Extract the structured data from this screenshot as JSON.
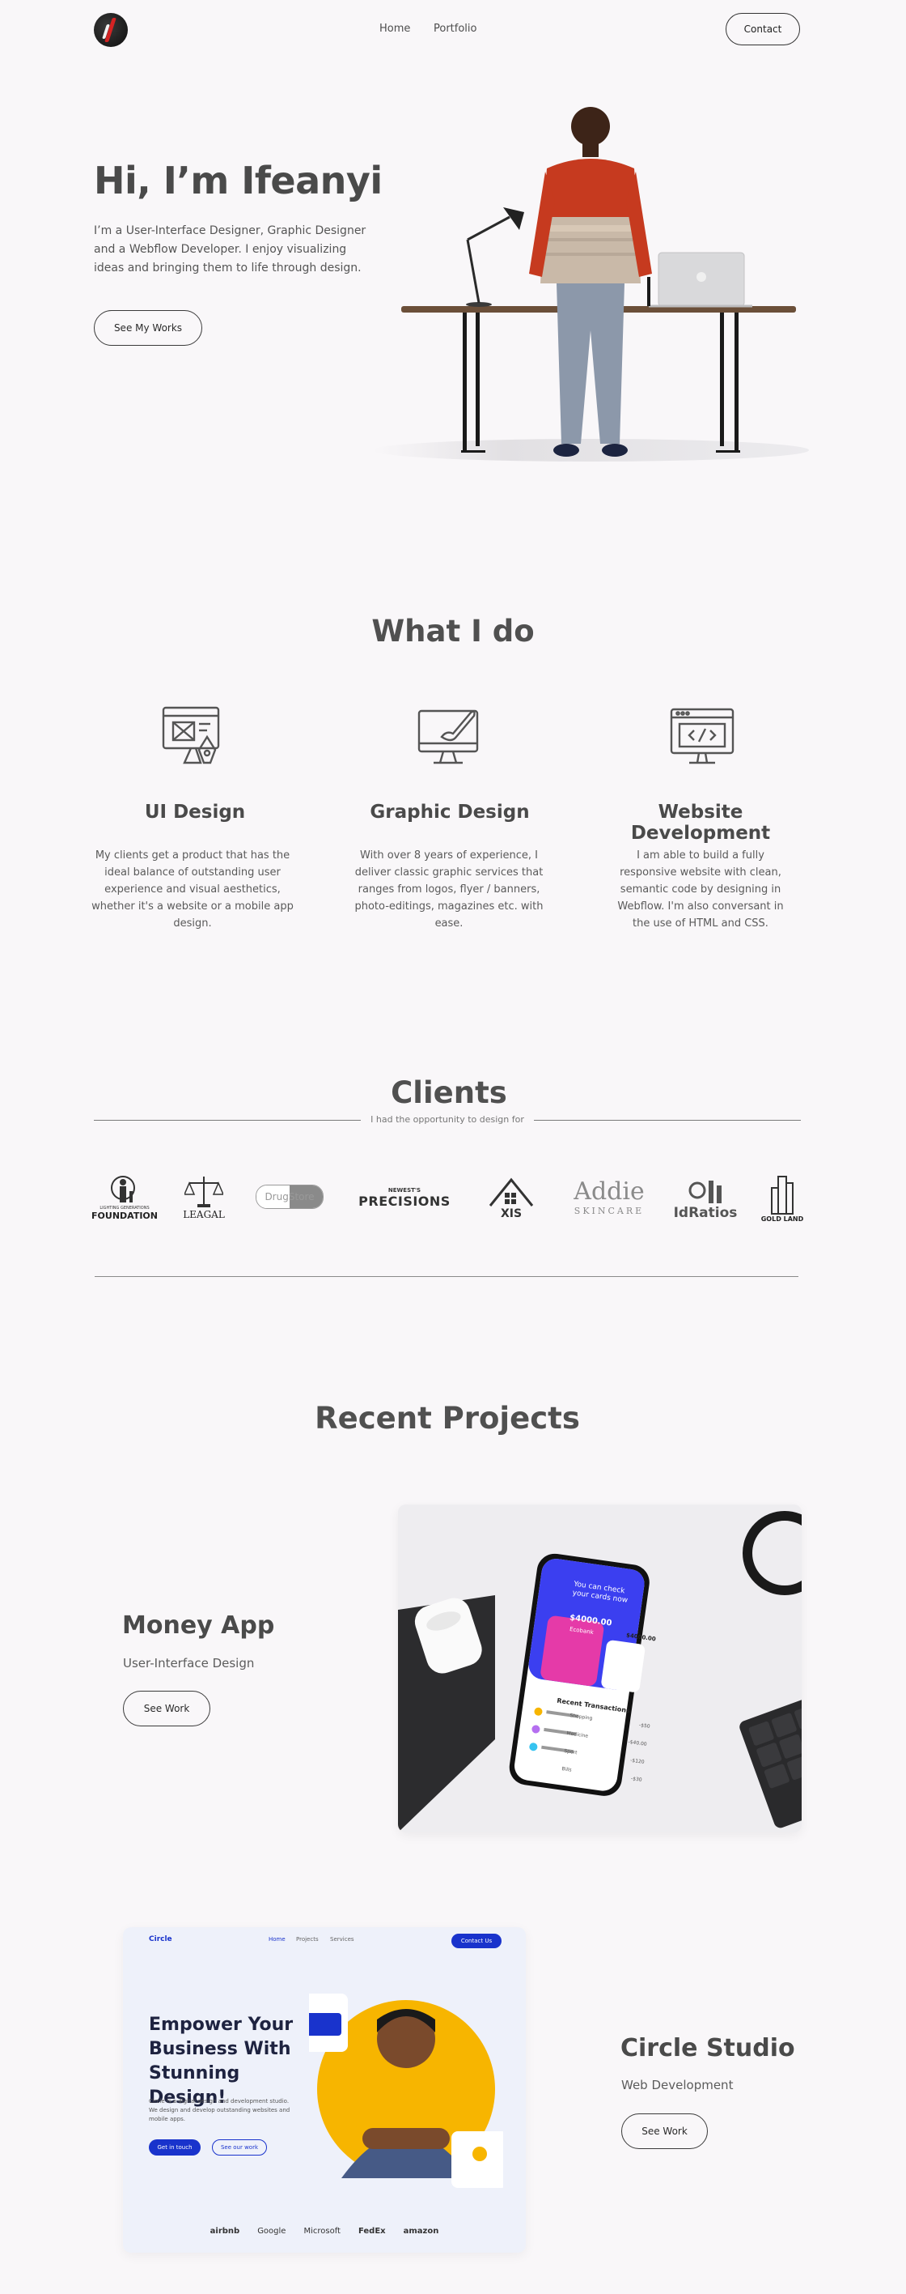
{
  "nav": {
    "links": [
      "Home",
      "Portfolio"
    ],
    "contact_label": "Contact"
  },
  "hero": {
    "title": "Hi, I’m Ifeanyi",
    "description": "I’m a User-Interface Designer, Graphic Designer and a Webflow Developer. I enjoy visualizing ideas and bringing them to life through design.",
    "button_label": "See My Works"
  },
  "services": {
    "title": "What I do",
    "items": [
      {
        "icon": "ui-design-icon",
        "title": "UI Design",
        "description": "My clients get a product that has the ideal balance of outstanding user experience and visual aesthetics, whether it's a website or a mobile app design."
      },
      {
        "icon": "graphic-design-icon",
        "title": "Graphic Design",
        "description": "With over 8 years of experience, I deliver classic graphic services that ranges from logos, flyer / banners, photo-editings, magazines etc. with ease."
      },
      {
        "icon": "code-monitor-icon",
        "title": "Website Development",
        "description": "I am able to build a fully responsive website with clean, semantic code by designing in Webflow. I'm also conversant in the use of HTML and CSS."
      }
    ]
  },
  "clients": {
    "title": "Clients",
    "subtitle": "I had the opportunity to design for",
    "logos": [
      {
        "name": "foundation-logo",
        "top": "LIGHTING GENERATIONS",
        "main": "FOUNDATION"
      },
      {
        "name": "leagal-logo",
        "main": "LEAGAL"
      },
      {
        "name": "drugstore-logo",
        "main": "DrugStore"
      },
      {
        "name": "precisions-logo",
        "top": "NEWEST'S",
        "main": "PRECISIONS"
      },
      {
        "name": "axis-logo",
        "main": "XIS"
      },
      {
        "name": "addie-logo",
        "main": "Addie",
        "sub": "SKINCARE"
      },
      {
        "name": "idratios-logo",
        "main": "IdRatios"
      },
      {
        "name": "goldland-logo",
        "main": "GOLD LAND"
      }
    ]
  },
  "projects": {
    "title": "Recent Projects",
    "items": [
      {
        "title": "Money App",
        "subtitle": "User-Interface Design",
        "button_label": "See Work",
        "mock": {
          "headline": "You can check your cards now",
          "balance": "$4000.00",
          "card_type": "Ecobank",
          "side_balance": "$4000.00",
          "section": "Recent Transactions",
          "transactions": [
            {
              "name": "Shopping",
              "amount": "-$50"
            },
            {
              "name": "Medicine",
              "amount": "-$40.00"
            },
            {
              "name": "Sport",
              "amount": "-$120"
            },
            {
              "name": "Bills",
              "amount": "-$30"
            }
          ],
          "accent": "#3b3ff0"
        }
      },
      {
        "title": "Circle Studio",
        "subtitle": "Web Development",
        "button_label": "See Work",
        "mock": {
          "brand": "Circle",
          "nav": [
            "Home",
            "Projects",
            "Services"
          ],
          "contact": "Contact Us",
          "headline": "Empower Your Business With Stunning Design!",
          "body": "Circle is a digital design and development studio. We design and develop outstanding websites and mobile apps.",
          "cta_primary": "Get in touch",
          "cta_secondary": "See our work",
          "logos": [
            "airbnb",
            "Google",
            "Microsoft",
            "FedEx",
            "amazon"
          ],
          "accent": "#1933cc",
          "circle_color": "#f7b500"
        }
      }
    ]
  }
}
